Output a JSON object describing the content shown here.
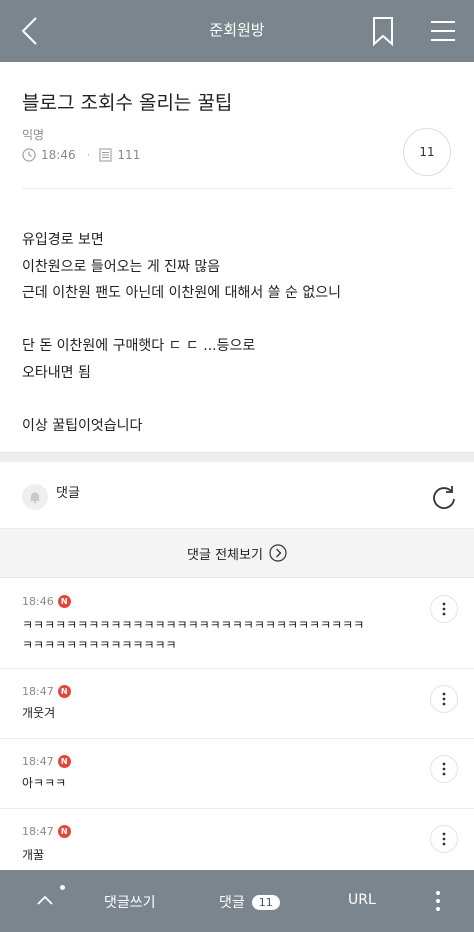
{
  "topbar": {
    "title": "준회원방"
  },
  "post": {
    "title": "블로그 조회수 올리는 꿀팁",
    "author": "익명",
    "time": "18:46",
    "views": "111",
    "comment_count": "11"
  },
  "body": {
    "lines": [
      "유입경로 보면",
      "이찬원으로 들어오는 게 진짜 많음",
      "근데 이찬원 팬도 아닌데 이찬원에 대해서 쓸 순 없으니",
      "",
      "단 돈 이찬원에 구매햇다 ㄷ ㄷ ...등으로",
      "오타내면 됨",
      "",
      "이상 꿀팁이엇습니다"
    ]
  },
  "comments_section": {
    "label": "댓글",
    "view_all": "댓글 전체보기"
  },
  "comments": [
    {
      "time": "18:46",
      "badge": "N",
      "lines": [
        "ㅋㅋㅋㅋㅋㅋㅋㅋㅋㅋㅋㅋㅋㅋㅋㅋㅋㅋㅋㅋㅋㅋㅋㅋㅋㅋㅋㅋㅋㅋㅋ",
        "ㅋㅋㅋㅋㅋㅋㅋㅋㅋㅋㅋㅋㅋㅋ"
      ]
    },
    {
      "time": "18:47",
      "badge": "N",
      "lines": [
        "개웃겨"
      ]
    },
    {
      "time": "18:47",
      "badge": "N",
      "lines": [
        "아ㅋㅋㅋ"
      ]
    },
    {
      "time": "18:47",
      "badge": "N",
      "lines": [
        "개꿀"
      ]
    }
  ],
  "bottombar": {
    "write": "댓글쓰기",
    "comments": "댓글",
    "comments_count": "11",
    "url": "URL"
  },
  "colors": {
    "bar": "#7b858e",
    "new_badge": "#e2473e"
  }
}
